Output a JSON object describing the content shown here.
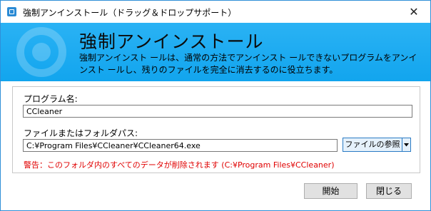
{
  "window": {
    "title": "強制アンインストール（ドラッグ＆ドロップサポート）",
    "close_label": "✕"
  },
  "banner": {
    "title": "強制アンインストール",
    "description": "強制アンインスト ールは、通常の方法でアンインスト ールできないプログラムをアンインスト ールし、残りのファイルを完全に消去するのに役立ちます。"
  },
  "form": {
    "program_name_label": "プログラム名:",
    "program_name_value": "CCleaner",
    "path_label": "ファイルまたはフォルダパス:",
    "path_value": "C:¥Program Files¥CCleaner¥CCleaner64.exe",
    "browse_label": "ファイルの参照",
    "warning": "警告：このフォルダ内のすべてのデータが削除されます (C:¥Program Files¥CCleaner)"
  },
  "actions": {
    "start_label": "開始",
    "close_label": "閉じる"
  },
  "colors": {
    "banner": "#1aaaf0",
    "warning": "#e00000",
    "accent_border": "#2a7bc4"
  }
}
